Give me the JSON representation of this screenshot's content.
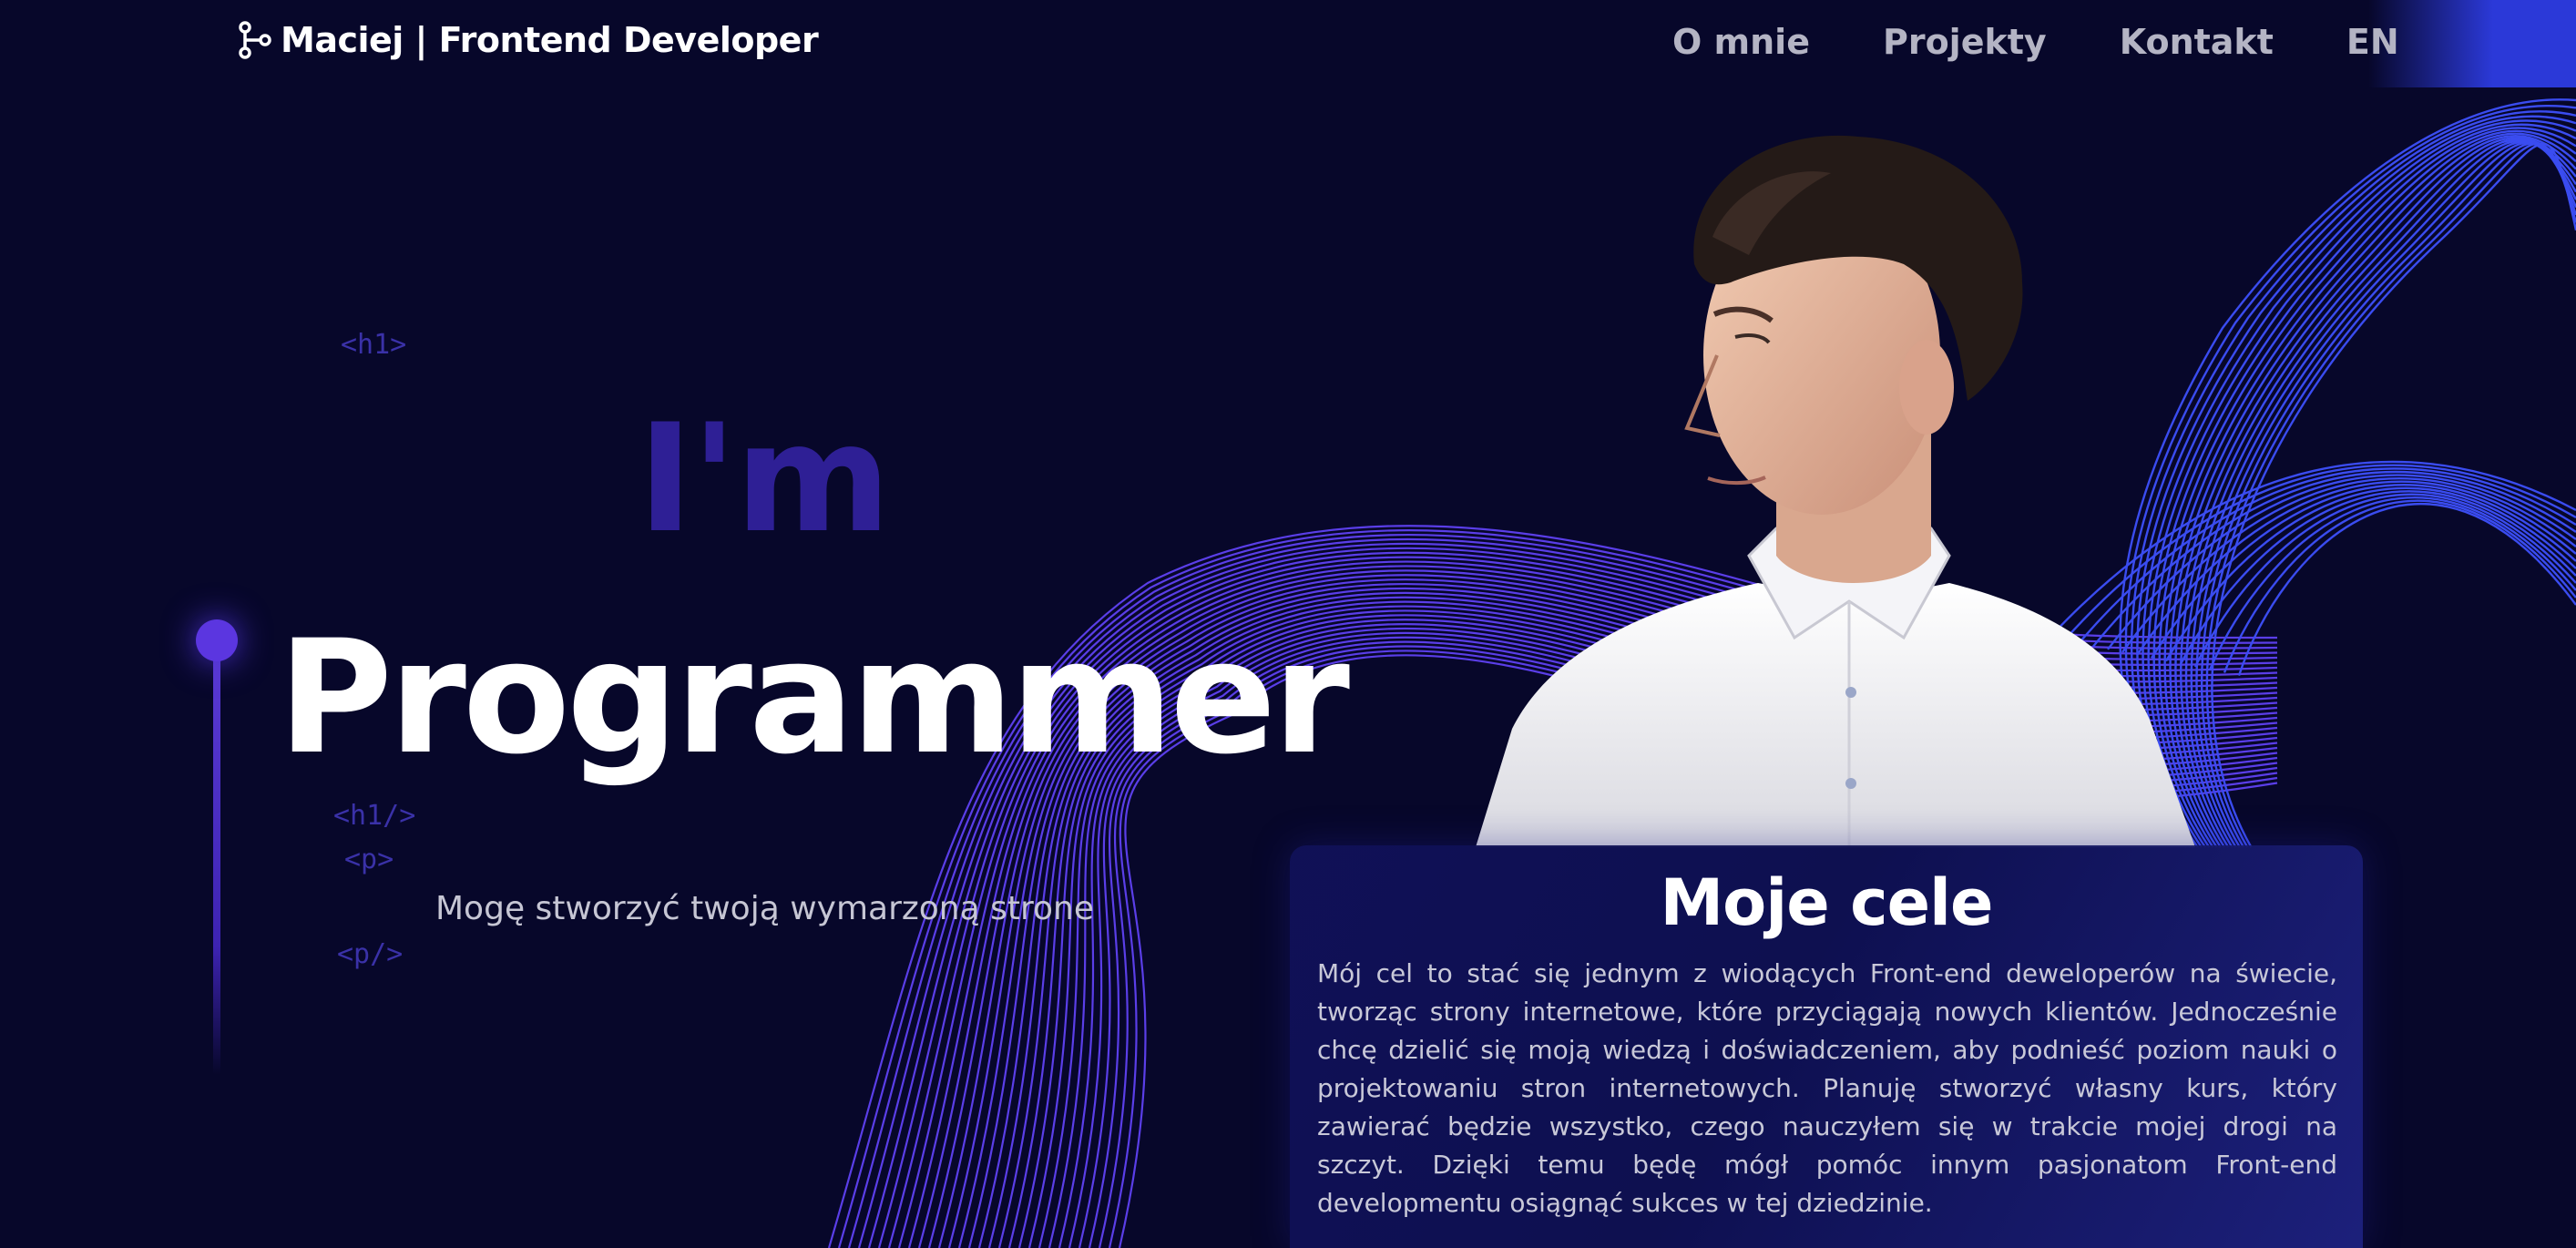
{
  "nav": {
    "logo_text": "Maciej | Frontend Developer",
    "logo_icon": "git-branch-icon",
    "links": [
      {
        "label": "O mnie"
      },
      {
        "label": "Projekty"
      },
      {
        "label": "Kontakt"
      },
      {
        "label": "EN"
      }
    ]
  },
  "hero": {
    "tag_h1_open": "<h1>",
    "im": "I'm",
    "title": "Programmer",
    "tag_h1_close": "<h1/>",
    "tag_p_open": "<p>",
    "subtitle": "Mogę stworzyć twoją wymarzoną strone",
    "tag_p_close": "<p/>"
  },
  "goals": {
    "title": "Moje cele",
    "text": "Mój cel to stać się jednym z wiodących Front-end deweloperów na świecie, tworząc strony internetowe, które przyciągają nowych klientów. Jednocześnie chcę dzielić się moją wiedzą i doświadczeniem, aby podnieść poziom nauki o projektowaniu stron internetowych. Planuję stworzyć własny kurs, który zawierać będzie wszystko, czego nauczyłem się w trakcie mojej drogi na szczyt. Dzięki temu będę mógł pomóc innym pasjonatom Front-end developmentu osiągnąć sukces w tej dziedzinie."
  },
  "colors": {
    "background": "#07072a",
    "accent": "#5b36e0",
    "wave_purple": "#5a3ee8",
    "wave_blue": "#3a4cf0",
    "im_color": "#2e1f95"
  }
}
